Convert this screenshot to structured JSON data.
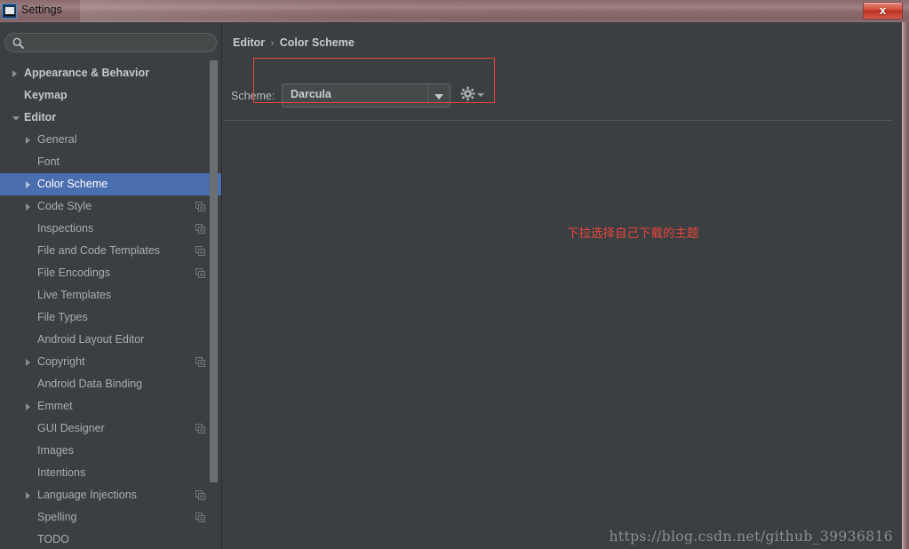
{
  "window": {
    "title": "Settings",
    "app_icon": "intellij-idea-icon",
    "close_label": "x"
  },
  "search": {
    "value": "",
    "placeholder": "",
    "icon": "search-icon"
  },
  "sidebar": {
    "items": [
      {
        "label": "Appearance & Behavior",
        "level": 0,
        "arrow": "right",
        "selected": false,
        "copy": false
      },
      {
        "label": "Keymap",
        "level": 0,
        "arrow": "none",
        "selected": false,
        "copy": false
      },
      {
        "label": "Editor",
        "level": 0,
        "arrow": "down",
        "selected": false,
        "copy": false
      },
      {
        "label": "General",
        "level": 1,
        "arrow": "right",
        "selected": false,
        "copy": false
      },
      {
        "label": "Font",
        "level": 1,
        "arrow": "none",
        "selected": false,
        "copy": false
      },
      {
        "label": "Color Scheme",
        "level": 1,
        "arrow": "right",
        "selected": true,
        "copy": false
      },
      {
        "label": "Code Style",
        "level": 1,
        "arrow": "right",
        "selected": false,
        "copy": true
      },
      {
        "label": "Inspections",
        "level": 1,
        "arrow": "none",
        "selected": false,
        "copy": true
      },
      {
        "label": "File and Code Templates",
        "level": 1,
        "arrow": "none",
        "selected": false,
        "copy": true
      },
      {
        "label": "File Encodings",
        "level": 1,
        "arrow": "none",
        "selected": false,
        "copy": true
      },
      {
        "label": "Live Templates",
        "level": 1,
        "arrow": "none",
        "selected": false,
        "copy": false
      },
      {
        "label": "File Types",
        "level": 1,
        "arrow": "none",
        "selected": false,
        "copy": false
      },
      {
        "label": "Android Layout Editor",
        "level": 1,
        "arrow": "none",
        "selected": false,
        "copy": false
      },
      {
        "label": "Copyright",
        "level": 1,
        "arrow": "right",
        "selected": false,
        "copy": true
      },
      {
        "label": "Android Data Binding",
        "level": 1,
        "arrow": "none",
        "selected": false,
        "copy": false
      },
      {
        "label": "Emmet",
        "level": 1,
        "arrow": "right",
        "selected": false,
        "copy": false
      },
      {
        "label": "GUI Designer",
        "level": 1,
        "arrow": "none",
        "selected": false,
        "copy": true
      },
      {
        "label": "Images",
        "level": 1,
        "arrow": "none",
        "selected": false,
        "copy": false
      },
      {
        "label": "Intentions",
        "level": 1,
        "arrow": "none",
        "selected": false,
        "copy": false
      },
      {
        "label": "Language Injections",
        "level": 1,
        "arrow": "right",
        "selected": false,
        "copy": true
      },
      {
        "label": "Spelling",
        "level": 1,
        "arrow": "none",
        "selected": false,
        "copy": true
      },
      {
        "label": "TODO",
        "level": 1,
        "arrow": "none",
        "selected": false,
        "copy": false
      }
    ]
  },
  "content": {
    "breadcrumb": {
      "root": "Editor",
      "separator": "›",
      "leaf": "Color Scheme"
    },
    "scheme": {
      "label": "Scheme:",
      "selected": "Darcula",
      "options": [
        "Darcula"
      ],
      "gear_icon": "gear-icon",
      "dropdown_icon": "chevron-down-icon"
    }
  },
  "annotations": {
    "note": "下拉选择自己下载的主题",
    "note_color": "#e8463c",
    "highlight_color": "#e8463c",
    "watermark": "https://blog.csdn.net/github_39936816"
  },
  "colors": {
    "titlebar": "#8c6c6e",
    "panel_bg": "#3c3f41",
    "selection": "#4b6eaf",
    "text": "#a8adb0",
    "close_button": "#c0392b"
  }
}
